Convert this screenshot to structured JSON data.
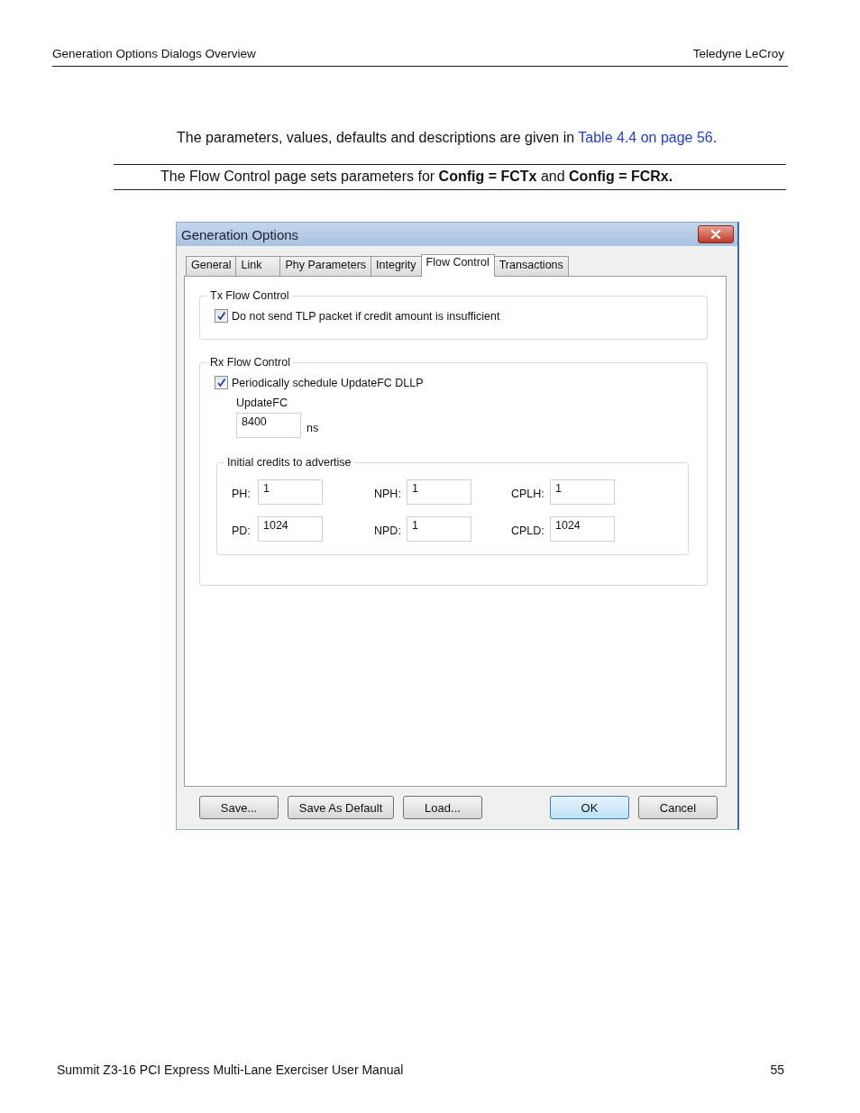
{
  "header": {
    "left": "Generation Options Dialogs Overview",
    "right": "Teledyne LeCroy"
  },
  "intro": {
    "before": "The parameters, values, defaults and descriptions are given in ",
    "link": "Table 4.4 on page 56",
    "after": "."
  },
  "note": "The Flow Control page sets parameters for **Config = FCTx** and **Config = FCRx.**",
  "dialog": {
    "title": "Generation Options",
    "tabs": [
      {
        "label": "General",
        "selected": false
      },
      {
        "label": "Link",
        "selected": false
      },
      {
        "label": "Phy Parameters",
        "selected": false
      },
      {
        "label": "Integrity",
        "selected": false
      },
      {
        "label": "Flow Control",
        "selected": true
      },
      {
        "label": "Transactions",
        "selected": false
      }
    ],
    "tx_group": {
      "title": "Tx Flow Control",
      "checkbox": {
        "label": "Do not send TLP packet if credit amount is insufficient",
        "checked": true
      }
    },
    "rx_group": {
      "title": "Rx Flow Control",
      "checkbox": {
        "label": "Periodically schedule UpdateFC DLLP",
        "checked": true
      },
      "updatefc": {
        "label": "UpdateFC",
        "value": "8400",
        "unit": "ns"
      },
      "credits": {
        "title": "Initial credits to advertise",
        "fields": [
          {
            "label": "PH:",
            "value": "1"
          },
          {
            "label": "NPH:",
            "value": "1"
          },
          {
            "label": "CPLH:",
            "value": "1"
          },
          {
            "label": "PD:",
            "value": "1024"
          },
          {
            "label": "NPD:",
            "value": "1"
          },
          {
            "label": "CPLD:",
            "value": "1024"
          }
        ]
      }
    },
    "buttons": [
      {
        "label": "Save...",
        "default": false
      },
      {
        "label": "Save As Default",
        "default": false
      },
      {
        "label": "Load...",
        "default": false
      },
      {
        "label": "OK",
        "default": true
      },
      {
        "label": "Cancel",
        "default": false
      }
    ]
  },
  "footer": {
    "title": "Summit Z3-16 PCI Express Multi-Lane Exerciser User Manual",
    "page": "55"
  }
}
